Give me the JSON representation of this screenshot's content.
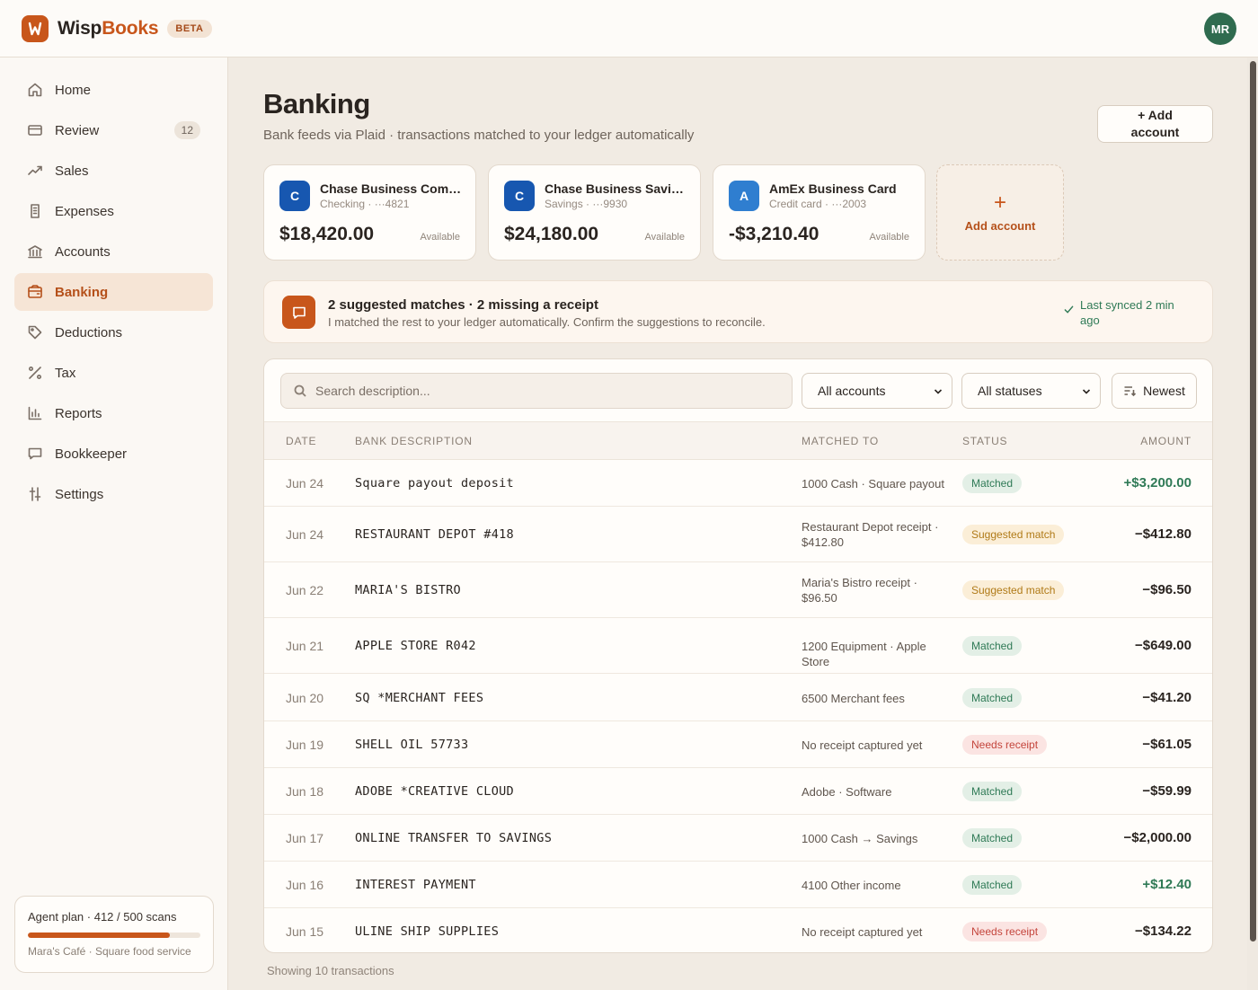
{
  "brand": {
    "name_part1": "Wisp",
    "name_part2": "Books",
    "badge": "BETA",
    "user_initials": "MR",
    "accent": "#c8561b"
  },
  "nav": [
    {
      "label": "Home",
      "icon": "home-icon"
    },
    {
      "label": "Review",
      "icon": "inbox-icon",
      "badge": "12"
    },
    {
      "label": "Sales",
      "icon": "trend-up-icon"
    },
    {
      "label": "Expenses",
      "icon": "receipt-icon"
    },
    {
      "label": "Accounts",
      "icon": "bank-icon"
    },
    {
      "label": "Banking",
      "icon": "wallet-icon",
      "active": true
    },
    {
      "label": "Deductions",
      "icon": "tag-icon"
    },
    {
      "label": "Tax",
      "icon": "percent-icon"
    },
    {
      "label": "Reports",
      "icon": "bar-chart-icon"
    },
    {
      "label": "Bookkeeper",
      "icon": "chat-icon"
    },
    {
      "label": "Settings",
      "icon": "sliders-icon"
    }
  ],
  "plan": {
    "title": "Agent plan · 412 / 500 scans",
    "used": 412,
    "total": 500,
    "business": "Mara's Café · Square food service"
  },
  "page": {
    "title": "Banking",
    "subtitle": "Bank feeds via Plaid · transactions matched to your ledger automatically",
    "add_button": "+ Add account"
  },
  "accounts": [
    {
      "logo": "C",
      "name": "Chase Business Comp...",
      "meta": "Checking · ···4821",
      "balance": "$18,420.00",
      "avail": "Available"
    },
    {
      "logo": "C",
      "name": "Chase Business Savings",
      "meta": "Savings · ···9930",
      "balance": "$24,180.00",
      "avail": "Available"
    },
    {
      "logo": "A",
      "name": "AmEx Business Card",
      "meta": "Credit card · ···2003",
      "balance": "-$3,210.40",
      "avail": "Available"
    }
  ],
  "add_account_tile": {
    "plus": "+",
    "label": "Add account"
  },
  "agent": {
    "title": "2 suggested matches · 2 missing a receipt",
    "subtitle": "I matched the rest to your ledger automatically. Confirm the suggestions to reconcile.",
    "sync": "Last synced 2 min ago"
  },
  "filters": {
    "search_placeholder": "Search description...",
    "accounts_select": "All accounts",
    "status_select": "All statuses",
    "sort": "Newest"
  },
  "table": {
    "headers": {
      "date": "DATE",
      "desc": "BANK DESCRIPTION",
      "match": "MATCHED TO",
      "status": "STATUS",
      "amount": "AMOUNT"
    },
    "rows": [
      {
        "date": "Jun 24",
        "desc": "Square payout deposit",
        "match": "1000 Cash · Square payout",
        "status": "Matched",
        "kind": "matched",
        "amount": "+$3,200.00",
        "pos": true
      },
      {
        "date": "Jun 24",
        "desc": "RESTAURANT DEPOT #418",
        "match": "Restaurant Depot receipt · $412.80",
        "status": "Suggested match",
        "kind": "suggested",
        "amount": "−$412.80",
        "pos": false
      },
      {
        "date": "Jun 22",
        "desc": "MARIA'S BISTRO",
        "match": "Maria's Bistro receipt · $96.50",
        "status": "Suggested match",
        "kind": "suggested",
        "amount": "−$96.50",
        "pos": false
      },
      {
        "date": "Jun 21",
        "desc": "APPLE STORE R042",
        "match": "1200 Equipment · Apple Store",
        "status": "Matched",
        "kind": "matched",
        "amount": "−$649.00",
        "pos": false
      },
      {
        "date": "Jun 20",
        "desc": "SQ *MERCHANT FEES",
        "match": "6500 Merchant fees",
        "status": "Matched",
        "kind": "matched",
        "amount": "−$41.20",
        "pos": false
      },
      {
        "date": "Jun 19",
        "desc": "SHELL OIL 57733",
        "match": "No receipt captured yet",
        "status": "Needs receipt",
        "kind": "needs",
        "amount": "−$61.05",
        "pos": false
      },
      {
        "date": "Jun 18",
        "desc": "ADOBE *CREATIVE CLOUD",
        "match": "Adobe · Software",
        "status": "Matched",
        "kind": "matched",
        "amount": "−$59.99",
        "pos": false
      },
      {
        "date": "Jun 17",
        "desc": "ONLINE TRANSFER TO SAVINGS",
        "match": "1000 Cash → Savings",
        "status": "Matched",
        "kind": "matched",
        "amount": "−$2,000.00",
        "pos": false
      },
      {
        "date": "Jun 16",
        "desc": "INTEREST PAYMENT",
        "match": "4100 Other income",
        "status": "Matched",
        "kind": "matched",
        "amount": "+$12.40",
        "pos": true
      },
      {
        "date": "Jun 15",
        "desc": "ULINE SHIP SUPPLIES",
        "match": "No receipt captured yet",
        "status": "Needs receipt",
        "kind": "needs",
        "amount": "−$134.22",
        "pos": false
      }
    ]
  },
  "footer": "Showing 10 transactions"
}
